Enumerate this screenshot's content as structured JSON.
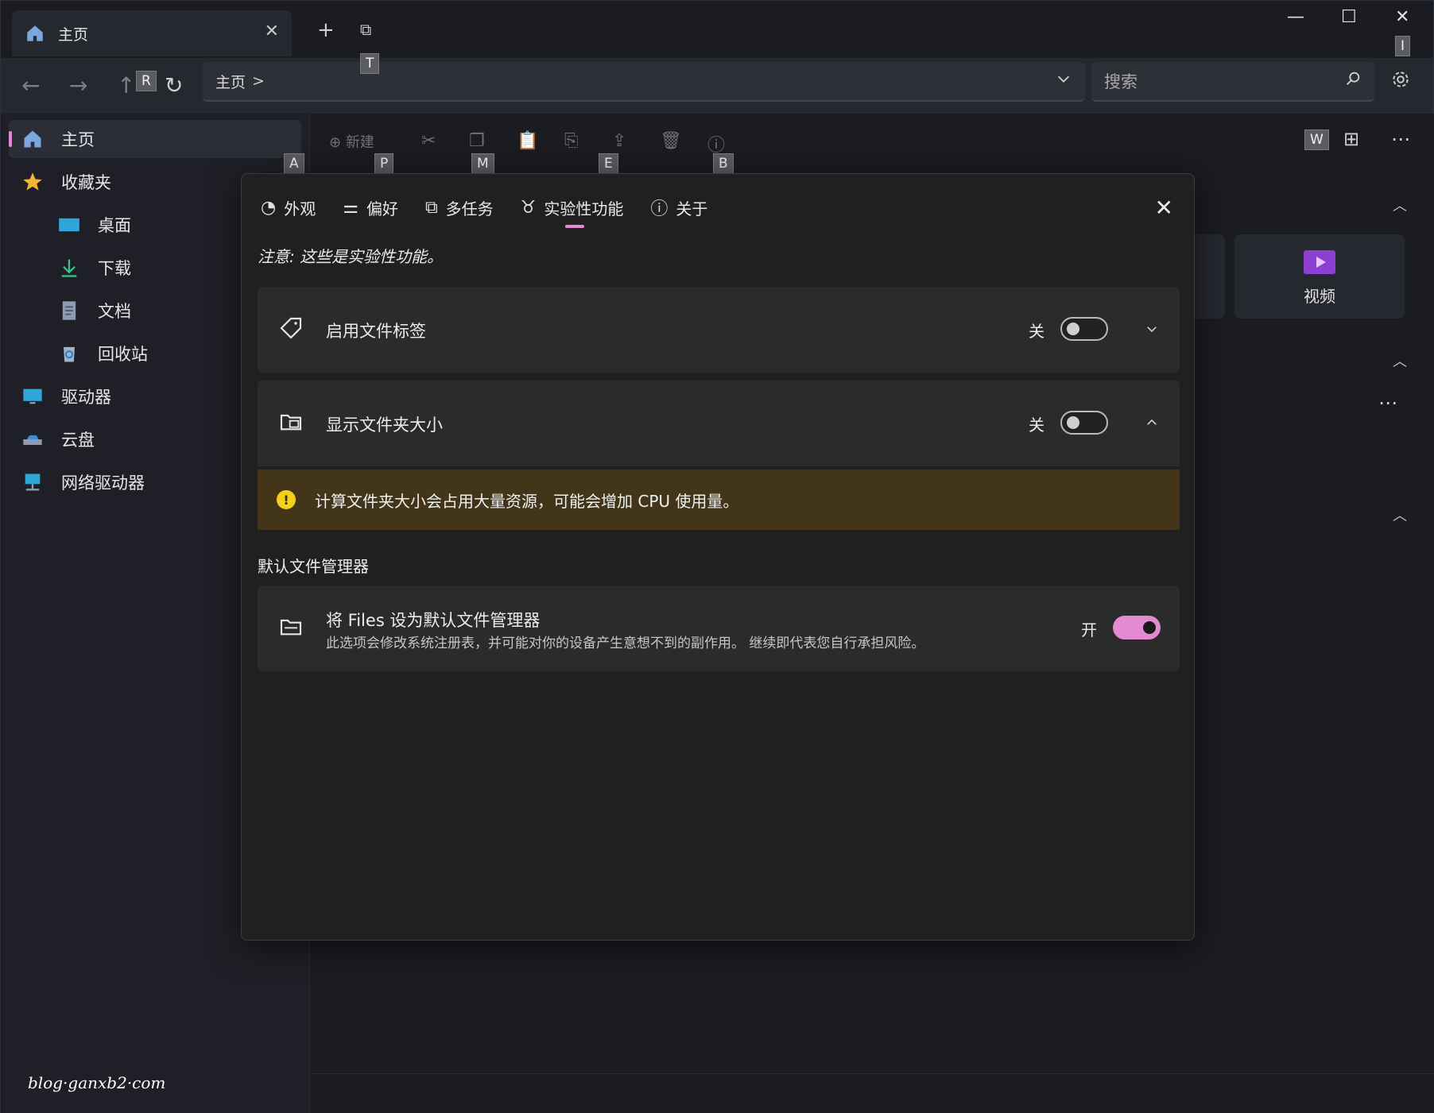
{
  "titlebar": {
    "tab_label": "主页",
    "tab_close": "✕",
    "new_tab": "+",
    "duplicate": "⧉",
    "minimize": "—",
    "maximize": "☐",
    "close": "✕"
  },
  "addressbar": {
    "path": "主页",
    "separator": ">",
    "search_placeholder": "搜索"
  },
  "sidebar": {
    "items": [
      {
        "label": "主页"
      },
      {
        "label": "收藏夹"
      },
      {
        "label": "桌面"
      },
      {
        "label": "下载"
      },
      {
        "label": "文档"
      },
      {
        "label": "回收站"
      },
      {
        "label": "驱动器"
      },
      {
        "label": "云盘"
      },
      {
        "label": "网络驱动器"
      }
    ]
  },
  "toolbar": {
    "new_label": "新建"
  },
  "keytips": {
    "T": "T",
    "R": "R",
    "I": "I",
    "A": "A",
    "P": "P",
    "M": "M",
    "E": "E",
    "B": "B",
    "W": "W"
  },
  "background": {
    "videos_label": "视频"
  },
  "dialog": {
    "tabs": [
      {
        "label": "外观"
      },
      {
        "label": "偏好"
      },
      {
        "label": "多任务"
      },
      {
        "label": "实验性功能"
      },
      {
        "label": "关于"
      }
    ],
    "note": "注意: 这些是实验性功能。",
    "settings": [
      {
        "title": "启用文件标签",
        "state": "关",
        "on": false
      },
      {
        "title": "显示文件夹大小",
        "state": "关",
        "on": false
      }
    ],
    "warning": "计算文件夹大小会占用大量资源，可能会增加 CPU 使用量。",
    "section_title": "默认文件管理器",
    "default_manager": {
      "title": "将 Files 设为默认文件管理器",
      "description": "此选项会修改系统注册表，并可能对你的设备产生意想不到的副作用。 继续即代表您自行承担风险。",
      "state": "开",
      "on": true
    }
  },
  "watermark": "blog·ganxb2·com",
  "colors": {
    "accent": "#e48ad2",
    "warning_bg": "#433519",
    "warning_icon": "#f5d01a"
  }
}
